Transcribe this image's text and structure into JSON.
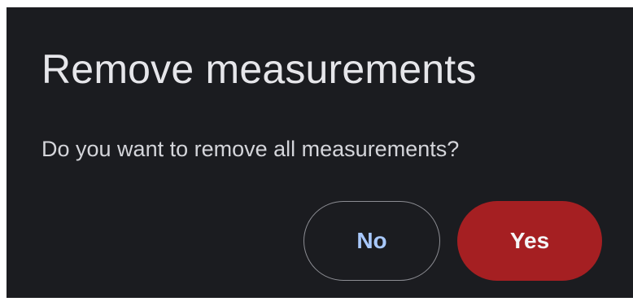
{
  "dialog": {
    "title": "Remove measurements",
    "message": "Do you want to remove all measurements?",
    "no_label": "No",
    "yes_label": "Yes"
  },
  "colors": {
    "background": "#1b1c20",
    "no_text": "#a8c8fb",
    "yes_background": "#a51f22"
  }
}
